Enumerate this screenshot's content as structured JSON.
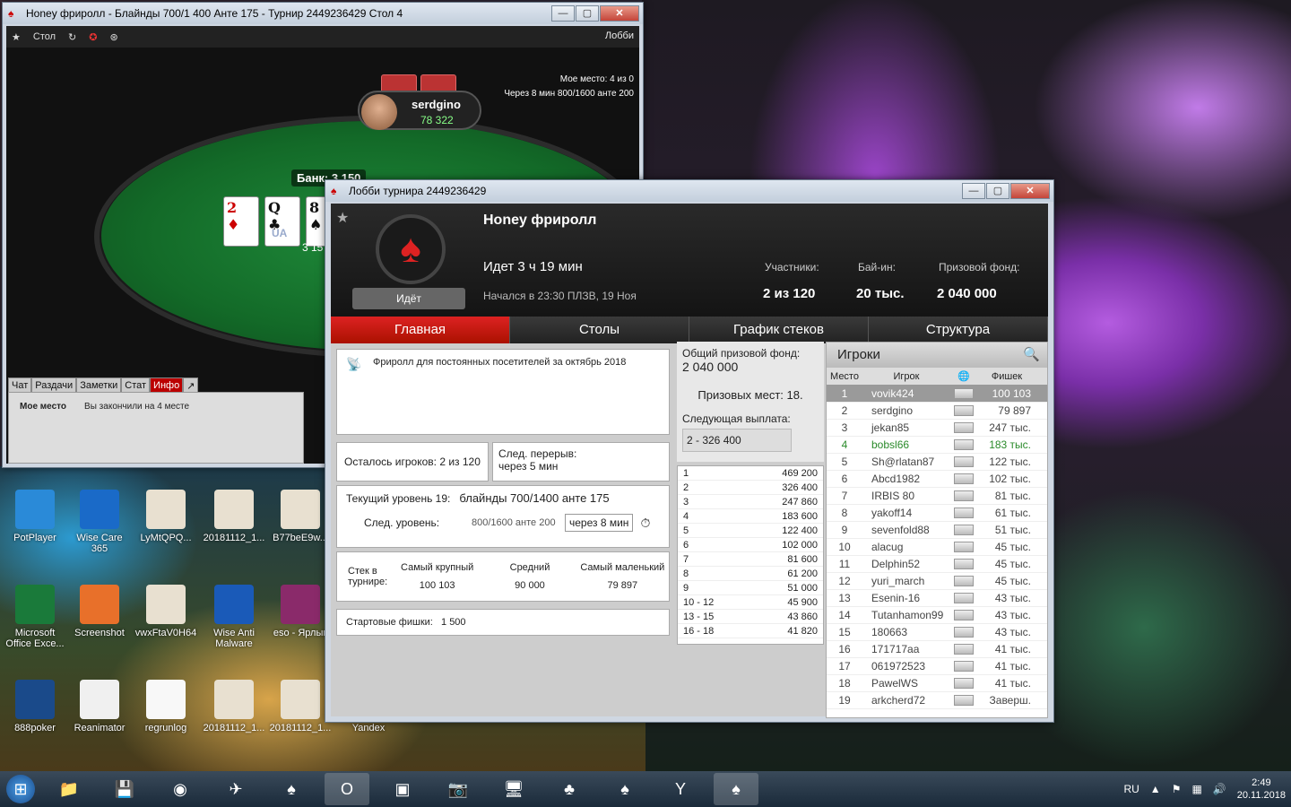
{
  "table_window": {
    "title": "Honey фриролл - Блайнды 700/1 400 Анте 175 - Турнир 2449236429 Стол 4",
    "toolbar": {
      "table_menu": "Стол",
      "lobby": "Лобби"
    },
    "my_place": "Мое место: 4 из 0",
    "next_level": "Через 8 мин 800/1600 анте 200",
    "pot": "Банк: 3 150",
    "cards": [
      {
        "rank": "2",
        "suit": "♦",
        "color": "red"
      },
      {
        "rank": "Q",
        "suit": "♣",
        "color": "black"
      },
      {
        "rank": "8",
        "suit": "♠",
        "color": "black"
      }
    ],
    "player": {
      "name": "serdgino",
      "stack": "78 322"
    },
    "seat_label": "UA",
    "seat_stack": "3 15",
    "chat_tabs": [
      "Чат",
      "Раздачи",
      "Заметки",
      "Стат",
      "Инфо",
      "↗"
    ],
    "info_label": "Мое место",
    "info_text": "Вы закончили на 4 месте"
  },
  "lobby": {
    "title": "Лобби турнира 2449236429",
    "name": "Honey фриролл",
    "status": "Идёт",
    "running": "Идет 3 ч 19 мин",
    "started": "Начался в 23:30 ПЛЗВ, 19 Ноя",
    "stats": {
      "entrants_label": "Участники:",
      "entrants": "2 из 120",
      "buyin_label": "Бай-ин:",
      "buyin": "20 тыс.",
      "prize_label": "Призовой фонд:",
      "prize": "2 040 000"
    },
    "tabs": [
      "Главная",
      "Столы",
      "График стеков",
      "Структура"
    ],
    "description": "Фриролл для постоянных посетителей за октябрь 2018",
    "remaining_label": "Осталось игроков:",
    "remaining": "2 из 120",
    "break_label": "След. перерыв:",
    "break": "через 5 мин",
    "level_label": "Текущий уровень 19:",
    "level": "блайнды 700/1400 анте 175",
    "next_level_label": "След. уровень:",
    "next_level": "800/1600 анте 200",
    "next_level_time": "через 8 мин",
    "stack_headers": [
      "Стек в турнире:",
      "Самый крупный",
      "Средний",
      "Самый маленький"
    ],
    "stack_values": [
      "100 103",
      "90 000",
      "79 897"
    ],
    "start_chips_label": "Стартовые фишки:",
    "start_chips": "1 500",
    "total_prize_label": "Общий призовой фонд:",
    "total_prize": "2 040 000",
    "paid_places": "Призовых мест: 18.",
    "next_payout_label": "Следующая выплата:",
    "next_payout": "2 - 326 400",
    "payouts": [
      [
        "1",
        "469 200"
      ],
      [
        "2",
        "326 400"
      ],
      [
        "3",
        "247 860"
      ],
      [
        "4",
        "183 600"
      ],
      [
        "5",
        "122 400"
      ],
      [
        "6",
        "102 000"
      ],
      [
        "7",
        "81 600"
      ],
      [
        "8",
        "61 200"
      ],
      [
        "9",
        "51 000"
      ],
      [
        "10 - 12",
        "45 900"
      ],
      [
        "13 - 15",
        "43 860"
      ],
      [
        "16 - 18",
        "41 820"
      ]
    ],
    "players_title": "Игроки",
    "players_cols": [
      "Место",
      "Игрок",
      "",
      "Фишек"
    ],
    "players": [
      [
        "1",
        "vovik424",
        "100 103"
      ],
      [
        "2",
        "serdgino",
        "79 897"
      ],
      [
        "3",
        "jekan85",
        "247 тыс."
      ],
      [
        "4",
        "bobsl66",
        "183 тыс."
      ],
      [
        "5",
        "Sh@rlatan87",
        "122 тыс."
      ],
      [
        "6",
        "Abcd1982",
        "102 тыс."
      ],
      [
        "7",
        "IRBIS 80",
        "81 тыс."
      ],
      [
        "8",
        "yakoff14",
        "61 тыс."
      ],
      [
        "9",
        "sevenfold88",
        "51 тыс."
      ],
      [
        "10",
        "alacug",
        "45 тыс."
      ],
      [
        "11",
        "Delphin52",
        "45 тыс."
      ],
      [
        "12",
        "yuri_march",
        "45 тыс."
      ],
      [
        "13",
        "Esenin-16",
        "43 тыс."
      ],
      [
        "14",
        "Tutanhamon99",
        "43 тыс."
      ],
      [
        "15",
        "180663",
        "43 тыс."
      ],
      [
        "16",
        "171717aa",
        "41 тыс."
      ],
      [
        "17",
        "061972523",
        "41 тыс."
      ],
      [
        "18",
        "PawelWS",
        "41 тыс."
      ],
      [
        "19",
        "arkcherd72",
        "Заверш."
      ]
    ]
  },
  "desktop_icons": [
    [
      "PotPlayer",
      "#2a8ad8"
    ],
    [
      "Wise Care 365",
      "#1a6ac8"
    ],
    [
      "LyMtQPQ...",
      "#e8e0d0"
    ],
    [
      "20181112_1...",
      "#e8e0d0"
    ],
    [
      "B77beE9w...",
      "#e8e0d0"
    ],
    [
      "Microsoft Office Exce...",
      "#1a7a3a"
    ],
    [
      "Screenshot",
      "#e8702a"
    ],
    [
      "vwxFtaV0H64",
      "#e8e0d0"
    ],
    [
      "Wise Anti Malware",
      "#1a5ab8"
    ],
    [
      "eso - Ярлык",
      "#8a2a6a"
    ],
    [
      "888poker",
      "#1a4a8a"
    ],
    [
      "Reanimator",
      "#f0f0f0"
    ],
    [
      "regrunlog",
      "#f8f8f8"
    ],
    [
      "20181112_1...",
      "#e8e0d0"
    ],
    [
      "20181112_1...",
      "#e8e0d0"
    ],
    [
      "Yandex",
      "#transparent"
    ]
  ],
  "taskbar": {
    "lang": "RU",
    "time": "2:49",
    "date": "20.11.2018"
  }
}
